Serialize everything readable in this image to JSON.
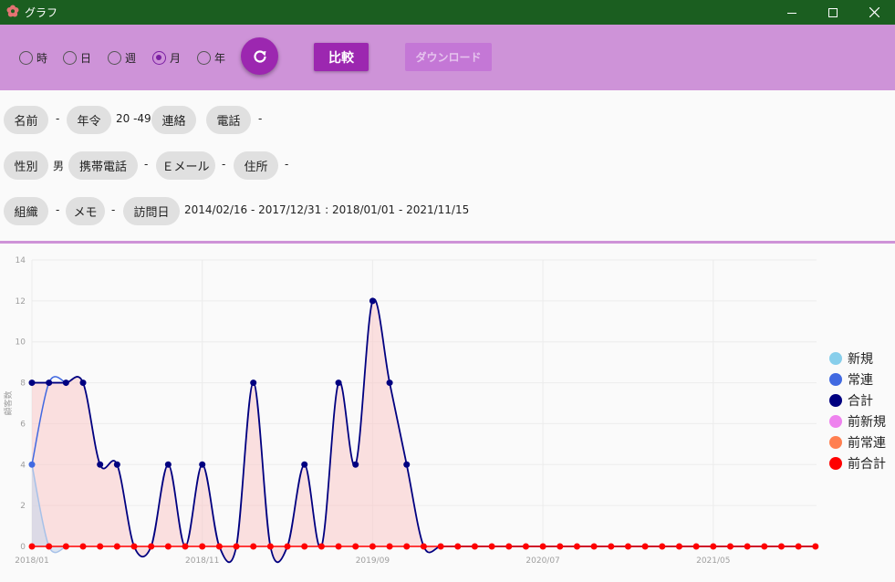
{
  "window": {
    "title": "グラフ",
    "minimize_icon": "minimize-icon",
    "maximize_icon": "maximize-icon",
    "close_icon": "close-icon"
  },
  "toolbar": {
    "radios": [
      {
        "label": "時",
        "checked": false
      },
      {
        "label": "日",
        "checked": false
      },
      {
        "label": "週",
        "checked": false
      },
      {
        "label": "月",
        "checked": true
      },
      {
        "label": "年",
        "checked": false
      }
    ],
    "refresh_icon": "refresh-icon",
    "compare_label": "比較",
    "download_label": "ダウンロード"
  },
  "filters": {
    "name_label": "名前",
    "name_value": "-",
    "age_label": "年令",
    "age_value": "20 -49",
    "contact_label": "連絡",
    "phone_label": "電話",
    "phone_value": "-",
    "gender_label": "性別",
    "gender_value": "男",
    "mobile_label": "携帯電話",
    "mobile_value": "-",
    "email_label": "Ｅメール",
    "email_value": "-",
    "address_label": "住所",
    "address_value": "-",
    "org_label": "組織",
    "org_value": "-",
    "memo_label": "メモ",
    "memo_value": "-",
    "visit_label": "訪問日",
    "visit_value": "2014/02/16 - 2017/12/31 : 2018/01/01 - 2021/11/15"
  },
  "colors": {
    "titlebar": "#1b5e20",
    "toolbar": "#ce93d8",
    "accent": "#9c27b0",
    "new": "#87ceeb",
    "regular": "#4169e1",
    "total": "#000080",
    "prev_new": "#ee82ee",
    "prev_regular": "#ff7f50",
    "prev_total": "#ff0000"
  },
  "chart_data": {
    "type": "line",
    "ylabel": "顧客数",
    "ylim": [
      0,
      14
    ],
    "yticks": [
      "0",
      "2",
      "4",
      "6",
      "8",
      "10",
      "12",
      "14"
    ],
    "xtick_labels": [
      "2018/01",
      "2018/11",
      "2019/09",
      "2020/07",
      "2021/05"
    ],
    "xtick_index": [
      0,
      10,
      20,
      30,
      40
    ],
    "num_points": 47,
    "legend_position": "right",
    "grid": true,
    "series": [
      {
        "name": "新規",
        "color": "#87ceeb",
        "values": [
          4,
          0,
          0,
          0,
          0,
          0,
          0,
          0,
          0,
          0,
          0,
          0,
          0,
          0,
          0,
          0,
          0,
          0,
          0,
          0,
          0,
          0,
          0,
          0,
          0,
          0,
          0,
          0,
          0,
          0,
          0,
          0,
          0,
          0,
          0,
          0,
          0,
          0,
          0,
          0,
          0,
          0,
          0,
          0,
          0,
          0,
          0
        ]
      },
      {
        "name": "常連",
        "color": "#4169e1",
        "values": [
          4,
          8,
          8,
          8,
          4,
          4,
          0,
          0,
          4,
          0,
          4,
          0,
          0,
          8,
          0,
          0,
          4,
          0,
          8,
          4,
          12,
          8,
          4,
          0,
          0,
          0,
          0,
          0,
          0,
          0,
          0,
          0,
          0,
          0,
          0,
          0,
          0,
          0,
          0,
          0,
          0,
          0,
          0,
          0,
          0,
          0,
          0
        ]
      },
      {
        "name": "合計",
        "color": "#000080",
        "values": [
          8,
          8,
          8,
          8,
          4,
          4,
          0,
          0,
          4,
          0,
          4,
          0,
          0,
          8,
          0,
          0,
          4,
          0,
          8,
          4,
          12,
          8,
          4,
          0,
          0,
          0,
          0,
          0,
          0,
          0,
          0,
          0,
          0,
          0,
          0,
          0,
          0,
          0,
          0,
          0,
          0,
          0,
          0,
          0,
          0,
          0,
          0
        ]
      },
      {
        "name": "前新規",
        "color": "#ee82ee",
        "values": [
          0,
          0,
          0,
          0,
          0,
          0,
          0,
          0,
          0,
          0,
          0,
          0,
          0,
          0,
          0,
          0,
          0,
          0,
          0,
          0,
          0,
          0,
          0,
          0,
          0,
          0,
          0,
          0,
          0,
          0,
          0,
          0,
          0,
          0,
          0,
          0,
          0,
          0,
          0,
          0,
          0,
          0,
          0,
          0,
          0,
          0,
          0
        ]
      },
      {
        "name": "前常連",
        "color": "#ff7f50",
        "values": [
          0,
          0,
          0,
          0,
          0,
          0,
          0,
          0,
          0,
          0,
          0,
          0,
          0,
          0,
          0,
          0,
          0,
          0,
          0,
          0,
          0,
          0,
          0,
          0,
          0,
          0,
          0,
          0,
          0,
          0,
          0,
          0,
          0,
          0,
          0,
          0,
          0,
          0,
          0,
          0,
          0,
          0,
          0,
          0,
          0,
          0,
          0
        ]
      },
      {
        "name": "前合計",
        "color": "#ff0000",
        "values": [
          0,
          0,
          0,
          0,
          0,
          0,
          0,
          0,
          0,
          0,
          0,
          0,
          0,
          0,
          0,
          0,
          0,
          0,
          0,
          0,
          0,
          0,
          0,
          0,
          0,
          0,
          0,
          0,
          0,
          0,
          0,
          0,
          0,
          0,
          0,
          0,
          0,
          0,
          0,
          0,
          0,
          0,
          0,
          0,
          0,
          0,
          0
        ]
      }
    ]
  }
}
